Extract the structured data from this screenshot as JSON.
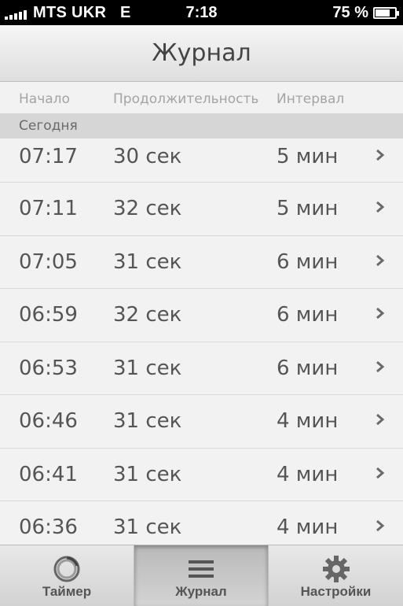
{
  "status_bar": {
    "carrier": "MTS UKR",
    "network": "E",
    "time": "7:18",
    "battery_percent": "75 %",
    "battery_level": 0.75
  },
  "nav": {
    "title": "Журнал"
  },
  "columns": {
    "start": "Начало",
    "duration": "Продолжительность",
    "interval": "Интервал"
  },
  "section": {
    "title": "Сегодня"
  },
  "rows": [
    {
      "start": "07:17",
      "duration": "30 сек",
      "interval": "5 мин"
    },
    {
      "start": "07:11",
      "duration": "32 сек",
      "interval": "5 мин"
    },
    {
      "start": "07:05",
      "duration": "31 сек",
      "interval": "6 мин"
    },
    {
      "start": "06:59",
      "duration": "32 сек",
      "interval": "6 мин"
    },
    {
      "start": "06:53",
      "duration": "31 сек",
      "interval": "6 мин"
    },
    {
      "start": "06:46",
      "duration": "31 сек",
      "interval": "4 мин"
    },
    {
      "start": "06:41",
      "duration": "31 сек",
      "interval": "4 мин"
    },
    {
      "start": "06:36",
      "duration": "31 сек",
      "interval": "4 мин"
    }
  ],
  "tabs": [
    {
      "label": "Таймер",
      "icon": "timer-ring-icon",
      "active": false
    },
    {
      "label": "Журнал",
      "icon": "list-icon",
      "active": true
    },
    {
      "label": "Настройки",
      "icon": "gear-icon",
      "active": false
    }
  ],
  "colors": {
    "status_bar_bg": "#000000",
    "background": "#f2f2f2",
    "section_bg": "#d6d6d6",
    "text": "#555555",
    "header_text": "#a4a4a4"
  }
}
